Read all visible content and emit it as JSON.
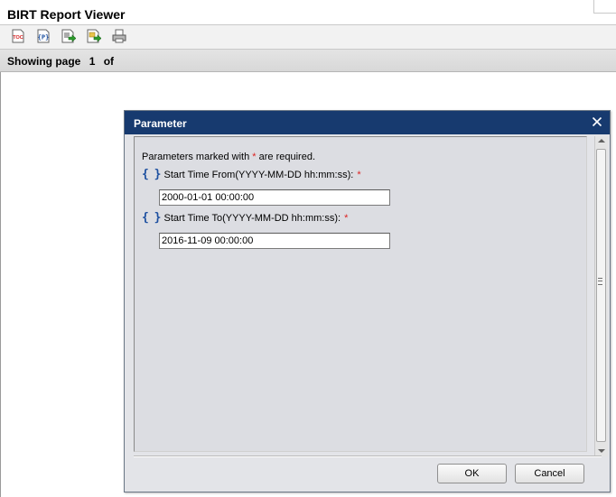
{
  "app": {
    "title": "BIRT Report Viewer"
  },
  "toolbar": {
    "buttons": [
      {
        "icon": "toc-icon"
      },
      {
        "icon": "parameters-icon"
      },
      {
        "icon": "export-data-icon"
      },
      {
        "icon": "export-report-icon"
      },
      {
        "icon": "print-icon"
      }
    ]
  },
  "navbar": {
    "showing_label": "Showing page",
    "page_number": "1",
    "of_label": "of"
  },
  "dialog": {
    "title": "Parameter",
    "required_note_prefix": "Parameters marked with",
    "required_marker": "*",
    "required_note_suffix": "are required.",
    "params": [
      {
        "label": "Start Time From(YYYY-MM-DD hh:mm:ss):",
        "value": "2000-01-01 00:00:00",
        "required": true
      },
      {
        "label": "Start Time To(YYYY-MM-DD hh:mm:ss):",
        "value": "2016-11-09 00:00:00",
        "required": true
      }
    ],
    "brace_glyph": "{ }",
    "ok_label": "OK",
    "cancel_label": "Cancel"
  },
  "colors": {
    "dialog_header": "#173a6f",
    "dialog_body": "#dcdde2",
    "required": "#dd2222",
    "brace": "#1c4fa0"
  }
}
